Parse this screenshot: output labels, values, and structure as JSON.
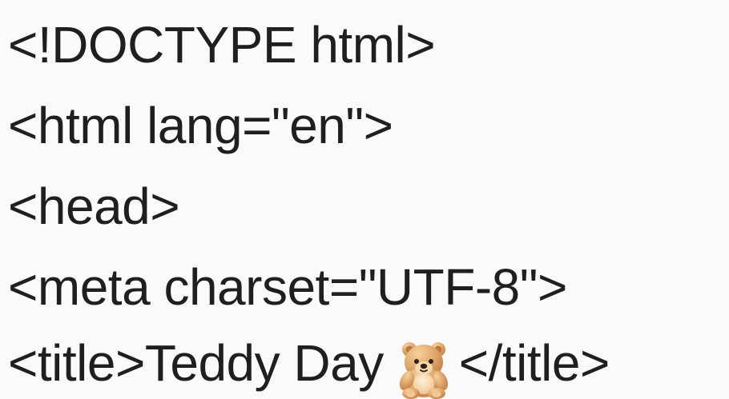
{
  "code": {
    "lines": [
      "<!DOCTYPE html>",
      "<html lang=\"en\">",
      "<head>",
      "<meta charset=\"UTF-8\">"
    ],
    "title_line": {
      "open_tag": "<title>",
      "text": "Teddy Day ",
      "emoji_icon": "teddy-bear-icon",
      "close_tag": "</title>"
    }
  },
  "colors": {
    "background": "#fafafa",
    "text": "#1f1f1f",
    "teddy_primary": "#d49a5e",
    "teddy_secondary": "#f0c08a"
  }
}
